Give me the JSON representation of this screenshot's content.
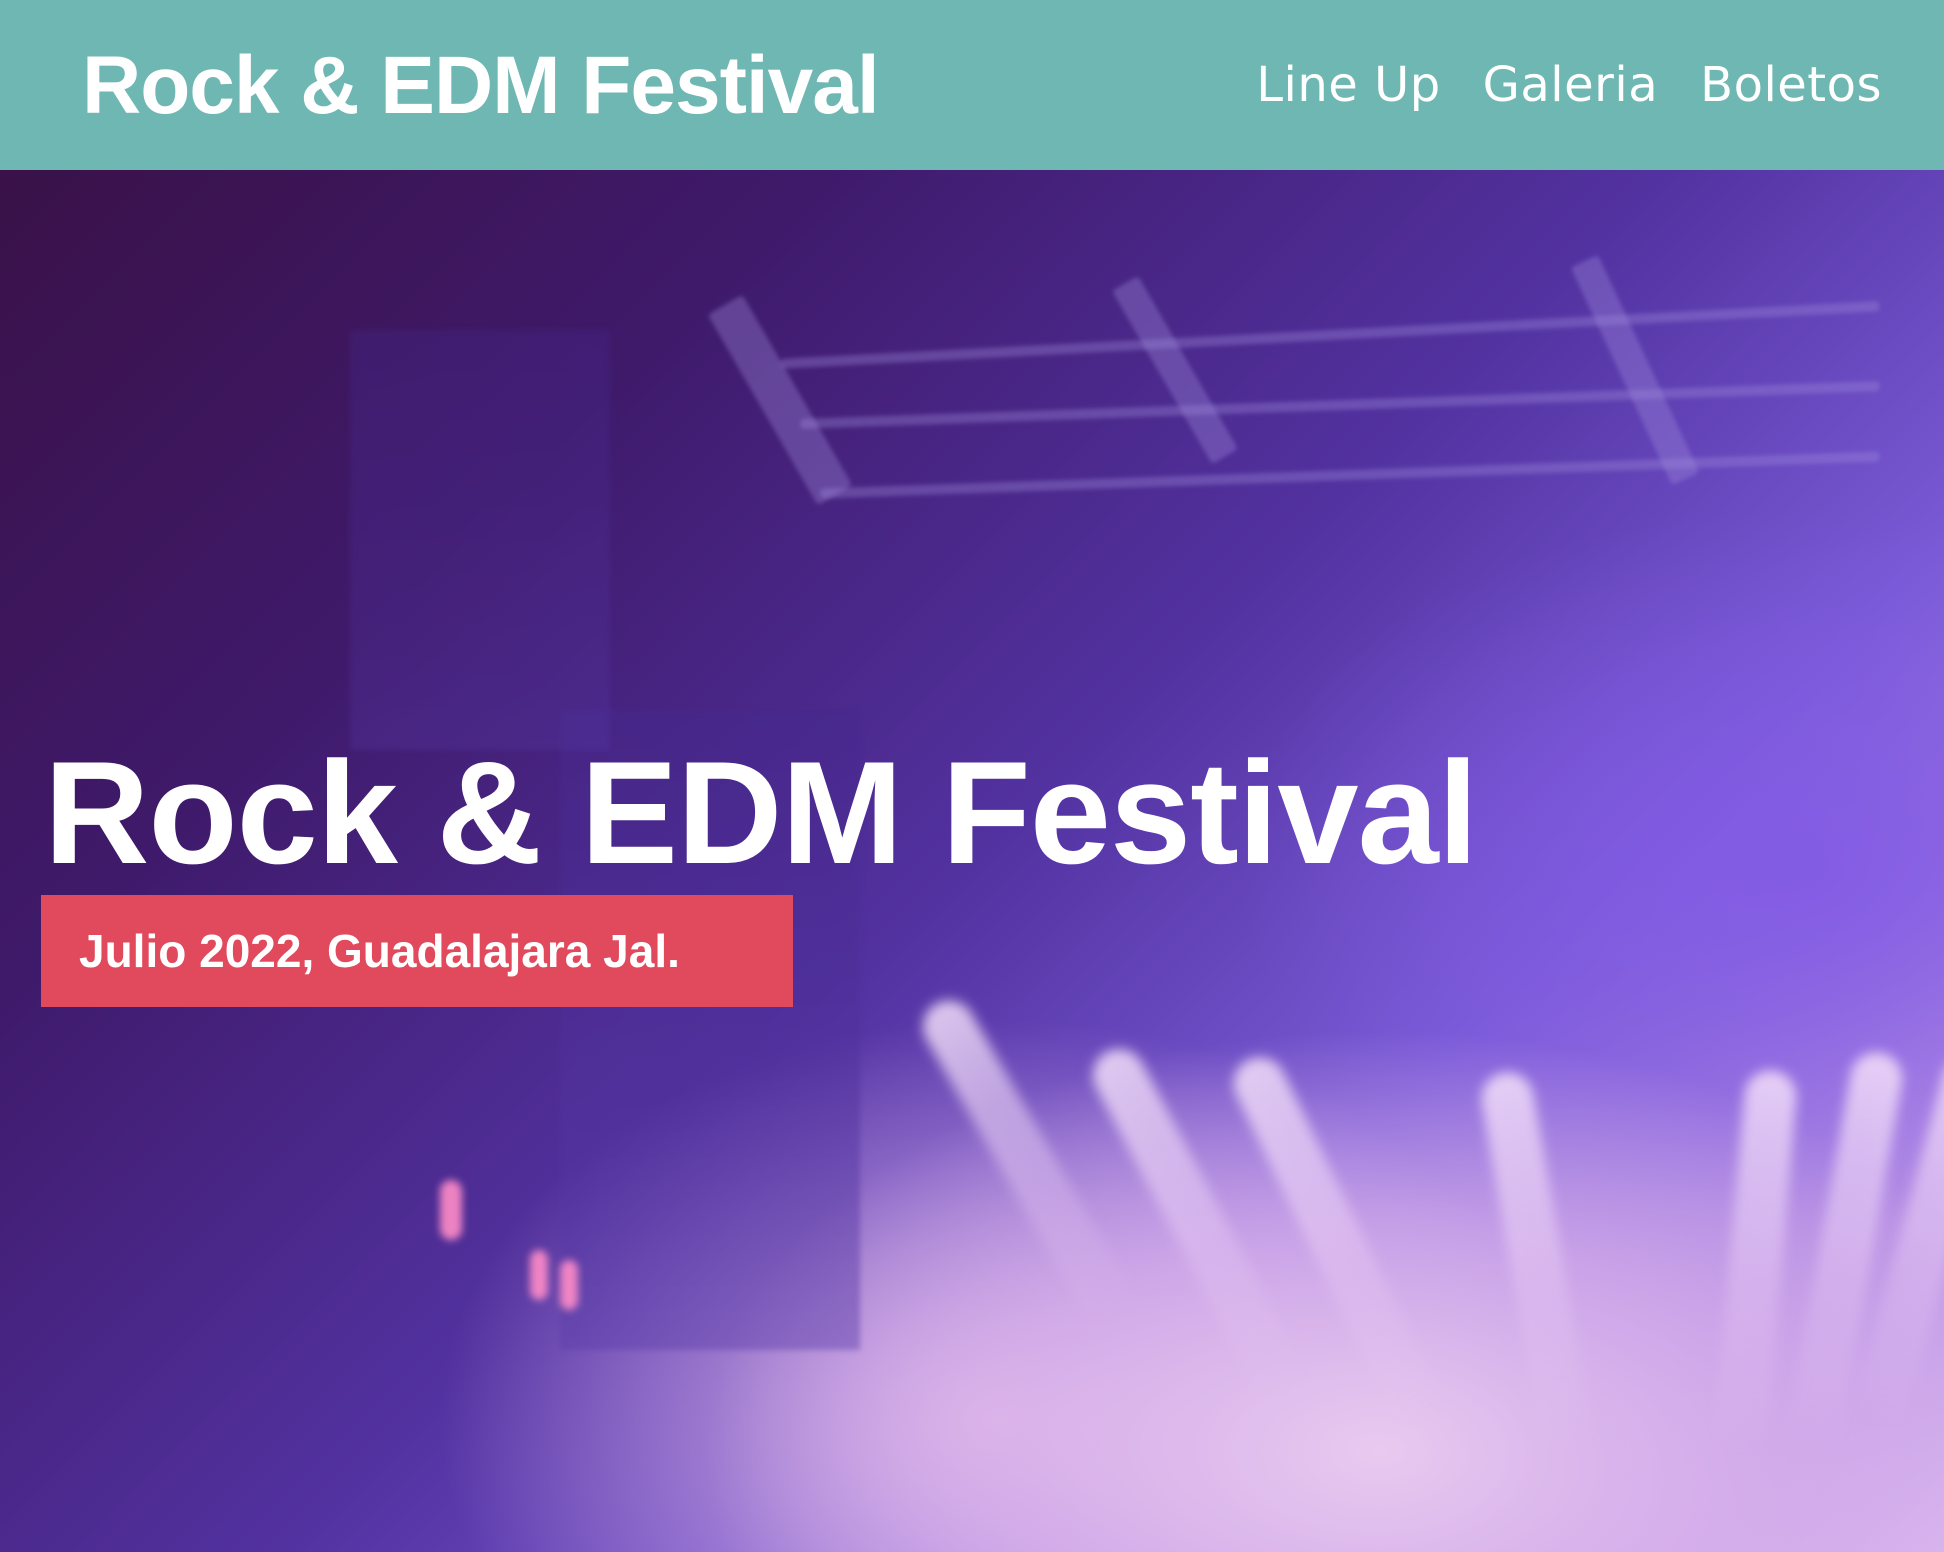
{
  "header": {
    "brand": "Rock & EDM Festival",
    "background_color": "#6fb7b2",
    "nav": [
      {
        "label": "Line Up"
      },
      {
        "label": "Galeria"
      },
      {
        "label": "Boletos"
      }
    ]
  },
  "hero": {
    "title": "Rock & EDM Festival",
    "badge": "Julio 2022, Guadalajara Jal.",
    "badge_color": "#e04a5c",
    "background_image": "concert-stage-lights"
  }
}
